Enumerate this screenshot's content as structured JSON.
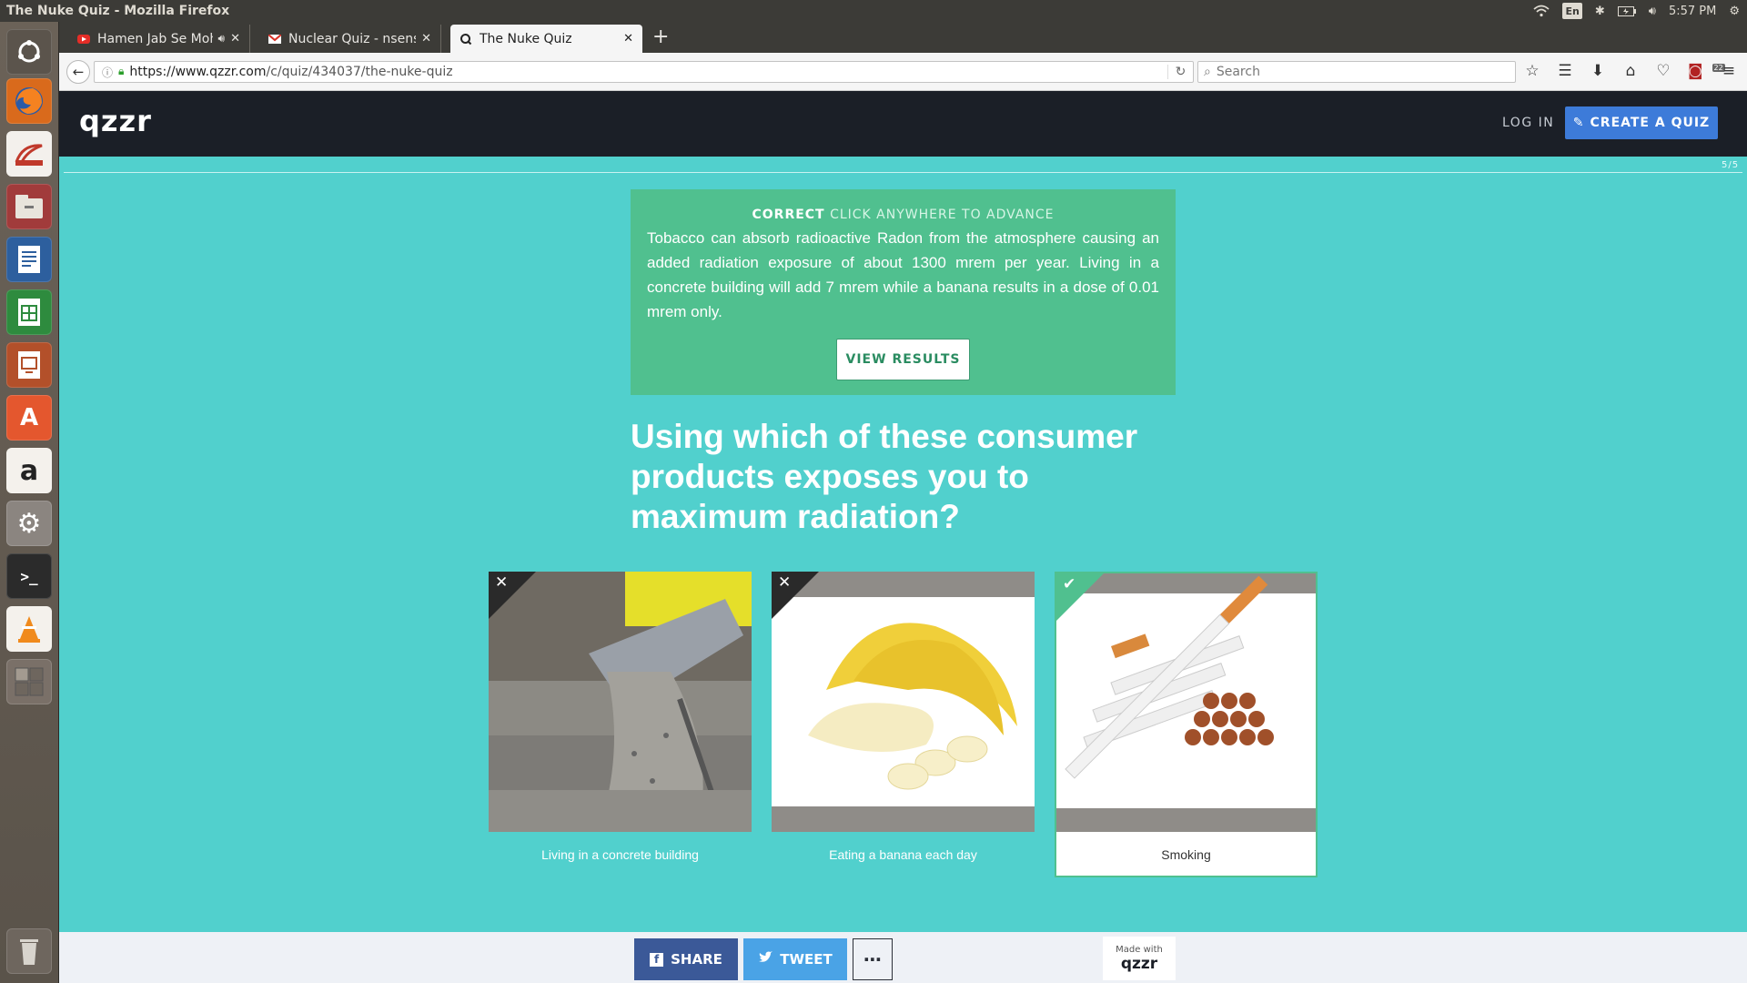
{
  "os": {
    "window_title": "The Nuke Quiz - Mozilla Firefox",
    "keyboard_layout": "En",
    "clock": "5:57 PM"
  },
  "browser": {
    "tabs": [
      {
        "label": "Hamen Jab Se Moha",
        "icon": "youtube-icon",
        "has_audio": true
      },
      {
        "label": "Nuclear Quiz - nsensha",
        "icon": "gmail-icon"
      },
      {
        "label": "The Nuke Quiz",
        "icon": "qzzr-icon",
        "active": true
      }
    ],
    "url_base": "https://www.qzzr.com",
    "url_path": "/c/quiz/434037/the-nuke-quiz",
    "search_placeholder": "Search",
    "addon_badge": "22"
  },
  "site": {
    "logo": "qzzr",
    "login_label": "LOG IN",
    "create_label": "CREATE A QUIZ",
    "progress_label": "5/5",
    "feedback": {
      "status": "CORRECT",
      "hint": "CLICK ANYWHERE TO ADVANCE",
      "text": "Tobacco can absorb radioactive Radon from the atmosphere causing an added radiation exposure of about 1300 mrem per year. Living in a concrete building will add 7 mrem while a banana results in a dose of 0.01 mrem only.",
      "button_label": "VIEW RESULTS"
    },
    "question": "Using which of these consumer products exposes you to maximum radiation?",
    "answers": [
      {
        "label": "Living in a concrete building",
        "result": "wrong"
      },
      {
        "label": "Eating a banana each day",
        "result": "wrong"
      },
      {
        "label": "Smoking",
        "result": "correct",
        "selected": true
      }
    ],
    "footer": {
      "share_label": "SHARE",
      "tweet_label": "TWEET",
      "made_with_label": "Made with",
      "made_with_logo": "qzzr"
    }
  },
  "colors": {
    "page_bg": "#51d0cd",
    "header_bg": "#1b1f27",
    "correct_green": "#50c08f",
    "create_blue": "#3d7bd9",
    "facebook_blue": "#3b5998",
    "twitter_blue": "#4aa3e6"
  }
}
